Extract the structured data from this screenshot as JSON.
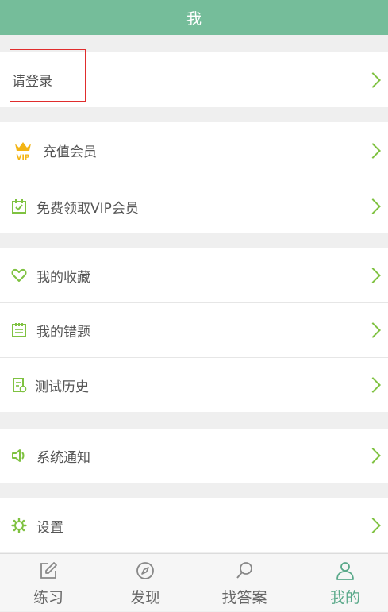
{
  "header": {
    "title": "我"
  },
  "login": {
    "label": "请登录"
  },
  "menu": {
    "recharge": "充值会员",
    "free_vip": "免费领取VIP会员",
    "favorites": "我的收藏",
    "mistakes": "我的错题",
    "history": "测试历史",
    "notifications": "系统通知",
    "settings": "设置"
  },
  "tabs": [
    {
      "label": "练习"
    },
    {
      "label": "发现"
    },
    {
      "label": "找答案"
    },
    {
      "label": "我的"
    }
  ],
  "colors": {
    "header": "#75bd9a",
    "accent": "#7fc241",
    "active_tab": "#5aa98a"
  }
}
